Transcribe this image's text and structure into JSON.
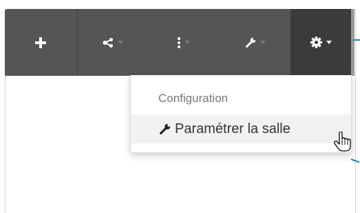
{
  "toolbar": {
    "buttons": [
      {
        "icon": "plus-icon"
      },
      {
        "icon": "share-icon",
        "has_dropdown": true
      },
      {
        "icon": "vertical-ellipsis-icon",
        "has_dropdown": true
      },
      {
        "icon": "wrench-icon",
        "has_dropdown": true
      },
      {
        "icon": "gear-icon",
        "has_dropdown": true,
        "active": true
      }
    ],
    "background": "#555555",
    "active_background": "#3b3b3b"
  },
  "dropdown": {
    "header": "Configuration",
    "items": [
      {
        "icon": "wrench-icon",
        "label": "Paramétrer la salle",
        "hovered": true
      }
    ]
  },
  "colors": {
    "callout_line": "#1f7fa8",
    "header_text": "#777777",
    "item_text": "#333333"
  }
}
